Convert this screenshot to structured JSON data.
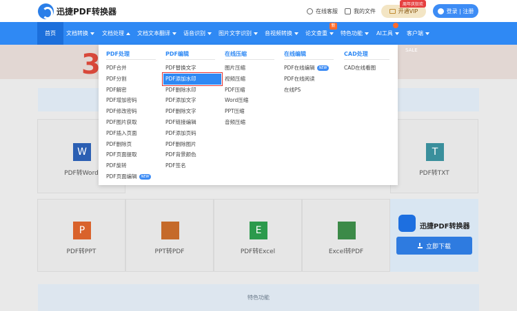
{
  "header": {
    "brand": "迅捷PDF转换器",
    "online_service": "在线客服",
    "my_files": "我的文件",
    "vip_label": "开通VIP",
    "vip_tag": "周年庆狂欢",
    "login": "登录 | 注册"
  },
  "nav": {
    "items": [
      {
        "label": "首页"
      },
      {
        "label": "文档转换"
      },
      {
        "label": "文档处理"
      },
      {
        "label": "文档文本翻译"
      },
      {
        "label": "语音识别"
      },
      {
        "label": "图片文字识别"
      },
      {
        "label": "音视频转换"
      },
      {
        "label": "论文查重"
      },
      {
        "label": "特色功能"
      },
      {
        "label": "AI工具"
      },
      {
        "label": "客户端"
      }
    ],
    "new_badge": "新"
  },
  "banner": {
    "big_number": "3",
    "sale": "SALE"
  },
  "menu": {
    "columns": [
      {
        "title": "PDF处理",
        "items": [
          "PDF合并",
          "PDF分割",
          "PDF解密",
          "PDF增加密码",
          "PDF修改密码",
          "PDF图片获取",
          "PDF插入页面",
          "PDF删除页",
          "PDF页面提取",
          "PDF旋转",
          "PDF页面编辑"
        ]
      },
      {
        "title": "PDF编辑",
        "items": [
          "PDF替换文字",
          "PDF添加水印",
          "PDF删除水印",
          "PDF添加文字",
          "PDF删除文字",
          "PDF链接编辑",
          "PDF添加页码",
          "PDF删除图片",
          "PDF背景颜色",
          "PDF签名"
        ]
      },
      {
        "title": "在线压缩",
        "items": [
          "图片压缩",
          "视频压缩",
          "PDF压缩",
          "Word压缩",
          "PPT压缩",
          "音频压缩"
        ]
      },
      {
        "title": "在线编辑",
        "items": [
          "PDF在线编辑",
          "PDF在线阅读",
          "在线PS"
        ]
      },
      {
        "title": "CAD处理",
        "items": [
          "CAD在线看图"
        ]
      }
    ],
    "new_pill": "NEW"
  },
  "cards": {
    "row1": [
      "PDF转Word",
      "PDF转TXT"
    ],
    "row2": [
      "PDF转PPT",
      "PPT转PDF",
      "PDF转Excel",
      "Excel转PDF"
    ],
    "icons": {
      "word": "W",
      "txt": "T",
      "ppt": "P",
      "excel": "E"
    }
  },
  "download": {
    "brand": "迅捷PDF转换器",
    "button": "立即下载"
  },
  "bottom": {
    "label": "特色功能"
  },
  "colors": {
    "primary": "#2f89f4",
    "active_outline": "#e03030"
  }
}
